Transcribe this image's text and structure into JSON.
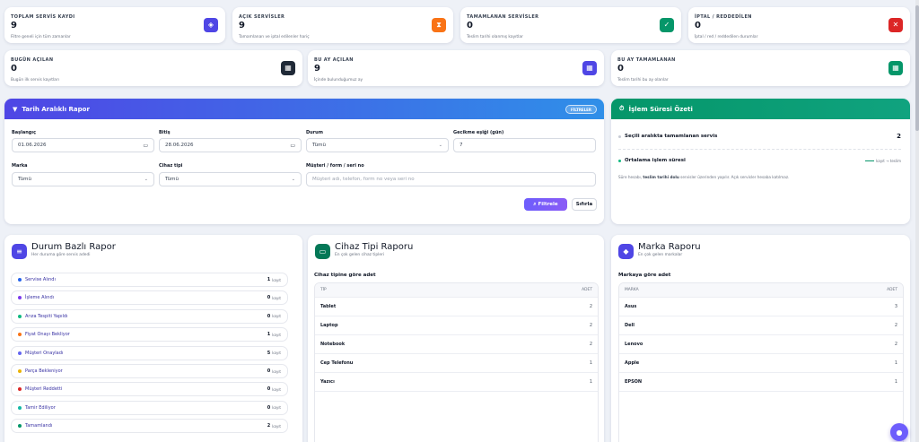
{
  "stats_top": [
    {
      "label": "TOPLAM SERVİS KAYDI",
      "value": "9",
      "sub": "Filtre geneli için tüm zamanlar",
      "icon": "layers-icon",
      "color": "#4f46e5"
    },
    {
      "label": "AÇIK SERVİSLER",
      "value": "9",
      "sub": "Tamamlanan ve iptal edilenler hariç",
      "icon": "hourglass-icon",
      "color": "#f97316"
    },
    {
      "label": "TAMAMLANAN SERVİSLER",
      "value": "0",
      "sub": "Teslim tarihi olanmış kayıtlar",
      "icon": "check-circle-icon",
      "color": "#059669"
    },
    {
      "label": "İPTAL / REDDEDİLEN",
      "value": "0",
      "sub": "İptal / red / reddedilen durumlar",
      "icon": "x-circle-icon",
      "color": "#dc2626"
    }
  ],
  "stats_second": [
    {
      "label": "BUGÜN AÇILAN",
      "value": "0",
      "sub": "Bugün ilk servis kayıtları",
      "icon": "calendar-day-icon",
      "color": "#1f2937"
    },
    {
      "label": "BU AY AÇILAN",
      "value": "9",
      "sub": "İçinde bulunduğumuz ay",
      "icon": "calendar-month-icon",
      "color": "#4f46e5"
    },
    {
      "label": "BU AY TAMAMLANAN",
      "value": "0",
      "sub": "Teslim tarihi bu ay olanlar",
      "icon": "calendar-check-icon",
      "color": "#059669"
    }
  ],
  "filter": {
    "title": "Tarih Aralıklı Rapor",
    "badge": "FİLTRELER",
    "labels": {
      "start": "Başlangıç",
      "end": "Bitiş",
      "status": "Durum",
      "delay": "Gecikme eşiği (gün)",
      "brand": "Marka",
      "device": "Cihaz tipi",
      "customer": "Müşteri / form / seri no"
    },
    "values": {
      "start": "01.06.2026",
      "end": "28.06.2026",
      "status": "Tümü",
      "delay": "7",
      "brand": "Tümü",
      "device": "Tümü"
    },
    "customer_placeholder": "Müşteri adı, telefon, form no veya seri no",
    "btn_filter": "Filtrele",
    "btn_reset": "Sıfırla"
  },
  "summary": {
    "title": "İşlem Süresi Özeti",
    "row1_label": "Seçili aralıkta tamamlanan servis",
    "row1_value": "2",
    "row2_label": "Ortalama işlem süresi",
    "row2_value": "kayıt → teslim",
    "note_pre": "Süre hesabı, ",
    "note_bold": "teslim tarihi dolu",
    "note_post": " servisler üzerinden yapılır. Açık servisler hesaba katılmaz."
  },
  "status_report": {
    "title": "Durum Bazlı Rapor",
    "subtitle": "Her duruma göre servis adedi",
    "unit": "kayıt",
    "rows": [
      {
        "name": "Servise Alındı",
        "count": "1",
        "color": "#2563eb"
      },
      {
        "name": "İşleme Alındı",
        "count": "0",
        "color": "#7c3aed"
      },
      {
        "name": "Arıza Tespiti Yapıldı",
        "count": "0",
        "color": "#10b981"
      },
      {
        "name": "Fiyat Onayı Bekliyor",
        "count": "1",
        "color": "#f97316"
      },
      {
        "name": "Müşteri Onayladı",
        "count": "5",
        "color": "#6366f1"
      },
      {
        "name": "Parça Bekleniyor",
        "count": "0",
        "color": "#eab308"
      },
      {
        "name": "Müşteri Reddetti",
        "count": "0",
        "color": "#dc2626"
      },
      {
        "name": "Tamir Ediliyor",
        "count": "0",
        "color": "#14b8a6"
      },
      {
        "name": "Tamamlandı",
        "count": "2",
        "color": "#059669"
      }
    ]
  },
  "device_report": {
    "title": "Cihaz Tipi Raporu",
    "subtitle": "En çok gelen cihaz tipleri",
    "caption": "Cihaz tipine göre adet",
    "col_name": "TİP",
    "col_count": "ADET",
    "rows": [
      {
        "name": "Tablet",
        "count": "2"
      },
      {
        "name": "Laptop",
        "count": "2"
      },
      {
        "name": "Notebook",
        "count": "2"
      },
      {
        "name": "Cep Telefonu",
        "count": "1"
      },
      {
        "name": "Yazıcı",
        "count": "1"
      }
    ]
  },
  "brand_report": {
    "title": "Marka Raporu",
    "subtitle": "En çok gelen markalar",
    "caption": "Markaya göre adet",
    "col_name": "MARKA",
    "col_count": "ADET",
    "rows": [
      {
        "name": "Asus",
        "count": "3"
      },
      {
        "name": "Dell",
        "count": "2"
      },
      {
        "name": "Lenovo",
        "count": "2"
      },
      {
        "name": "Apple",
        "count": "1"
      },
      {
        "name": "EPSON",
        "count": "1"
      }
    ]
  }
}
